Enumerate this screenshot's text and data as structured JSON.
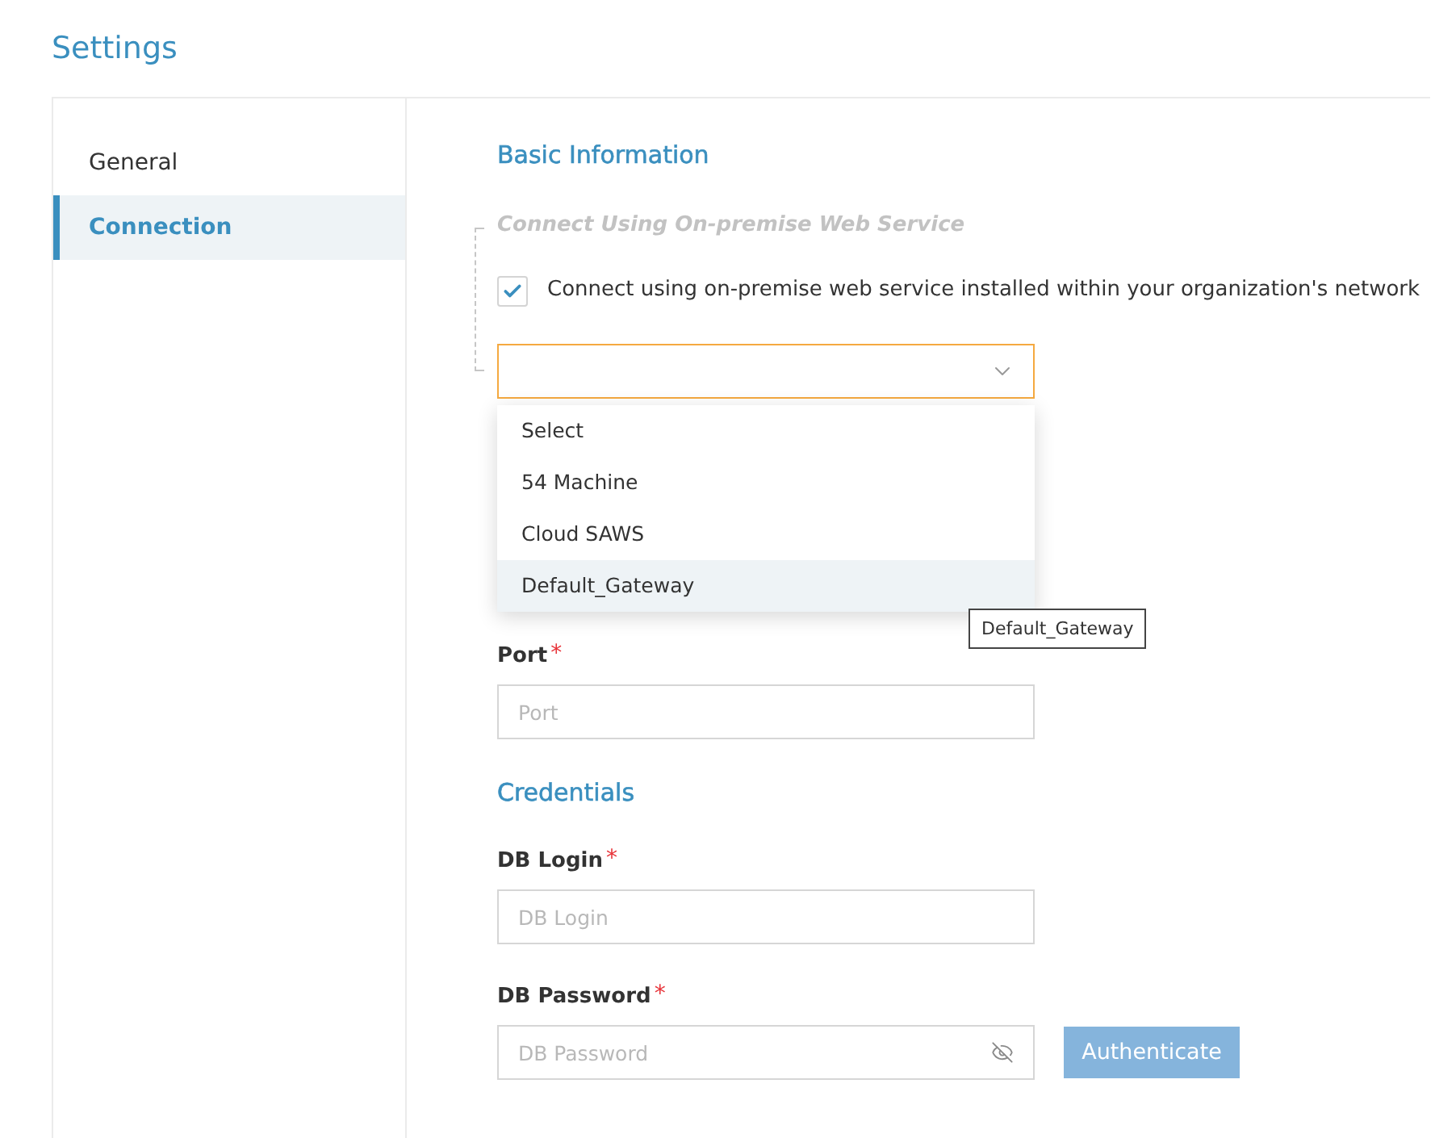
{
  "title": "Settings",
  "sidebar": {
    "items": [
      {
        "label": "General",
        "selected": false
      },
      {
        "label": "Connection",
        "selected": true
      }
    ]
  },
  "basic_information": {
    "heading": "Basic Information",
    "group": {
      "legend": "Connect Using On-premise Web Service",
      "checkbox": {
        "label": "Connect using on-premise web service installed within your organization's network",
        "checked": true
      },
      "dropdown": {
        "expanded": true,
        "options": [
          {
            "label": "Select",
            "highlighted": false
          },
          {
            "label": "54 Machine",
            "highlighted": false
          },
          {
            "label": "Cloud SAWS",
            "highlighted": false
          },
          {
            "label": "Default_Gateway",
            "highlighted": true
          }
        ],
        "tooltip": "Default_Gateway"
      }
    },
    "fields": [
      {
        "kind": "text",
        "label": "Port",
        "required_mark": "*",
        "placeholder": "Port"
      }
    ]
  },
  "credentials": {
    "heading": "Credentials",
    "fields": [
      {
        "kind": "text",
        "label": "DB Login",
        "required_mark": "*",
        "placeholder": "DB Login"
      },
      {
        "kind": "password",
        "label": "DB Password",
        "required_mark": "*",
        "placeholder": "DB Password"
      }
    ],
    "button": {
      "label": "Authenticate",
      "disabled": true
    }
  }
}
